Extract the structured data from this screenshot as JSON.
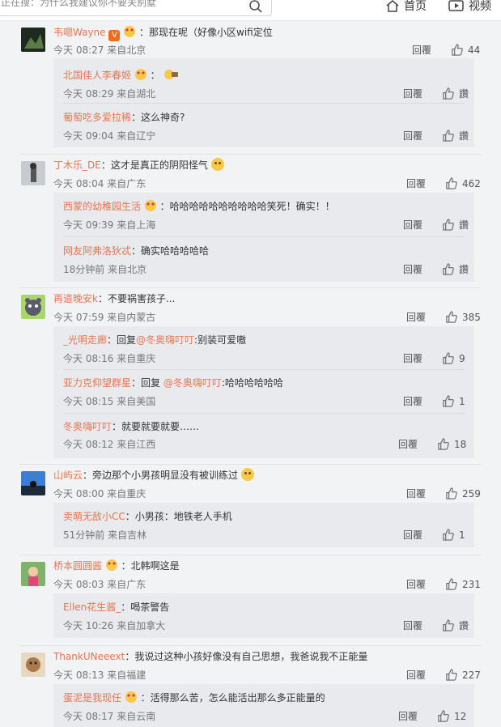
{
  "header": {
    "search_placeholder": "正在搜：为什么我建议你不要关别墅",
    "nav": [
      {
        "label": "首页",
        "icon": "home-icon"
      },
      {
        "label": "视频",
        "icon": "video-icon"
      }
    ]
  },
  "colors": {
    "name": "#eb7350",
    "reply_bg": "#e8eaed",
    "page_bg": "#f2f3f5"
  },
  "comments": [
    {
      "name": "韦嗯Wayne",
      "text": "：那现在呢（好像小区wifi定位",
      "meta": "今天 08:27 来自北京",
      "reply_label": "回覆",
      "likes": "44",
      "replies": [
        {
          "name": "北国佳人李春姬",
          "text": "：",
          "meta": "今天 08:29 来自湖北",
          "reply_label": "回覆",
          "likes": "讚"
        },
        {
          "name": "葡萄吃多爱拉稀",
          "text": "：这么神奇?",
          "meta": "今天 09:04 来自辽宁",
          "reply_label": "回覆",
          "likes": "讚"
        }
      ]
    },
    {
      "name": "丁木乐_DE",
      "text": "：这才是真正的阴阳怪气",
      "meta": "今天 08:04 来自广东",
      "reply_label": "回覆",
      "likes": "462",
      "replies": [
        {
          "name": "西蒙的幼稚园生活",
          "text": "：哈哈哈哈哈哈哈哈哈哈笑死！确实！！",
          "meta": "今天 09:39 来自上海",
          "reply_label": "回覆",
          "likes": "讚"
        },
        {
          "name": "网友阿弗洛狄忒",
          "text": "：确实哈哈哈哈哈",
          "meta": "18分钟前 来自北京",
          "reply_label": "回覆",
          "likes": "讚"
        }
      ]
    },
    {
      "name": "再道晚安k",
      "text": "：不要祸害孩子...",
      "meta": "今天 07:59 来自内蒙古",
      "reply_label": "回覆",
      "likes": "385",
      "replies": [
        {
          "name": "_光明走廊",
          "pre": "：回复",
          "mention": "@冬奥嗨叮叮",
          "text": ":别装可爱嗷",
          "meta": "今天 08:16 来自重庆",
          "reply_label": "回覆",
          "likes": "9"
        },
        {
          "name": "亚力克仰望群星",
          "pre": "：回复 ",
          "mention": "@冬奥嗨叮叮",
          "text": ":哈哈哈哈哈哈",
          "meta": "今天 08:15 来自美国",
          "reply_label": "回覆",
          "likes": "1"
        },
        {
          "name": "冬奥嗨叮叮",
          "text": "：就要就要就要……",
          "meta": "今天 08:12 来自江西",
          "reply_label": "回覆",
          "likes": "18"
        }
      ]
    },
    {
      "name": "山屿云",
      "text": "：旁边那个小男孩明显没有被训练过",
      "meta": "今天 08:00 来自重庆",
      "reply_label": "回覆",
      "likes": "259",
      "replies": [
        {
          "name": "卖萌无敌小CC",
          "text": "：小男孩：地铁老人手机",
          "meta": "51分钟前 来自吉林",
          "reply_label": "回覆",
          "likes": "1"
        }
      ]
    },
    {
      "name": "桥本圆圆酱",
      "text": "：北韩啊这是",
      "meta": "今天 08:03 来自广东",
      "reply_label": "回覆",
      "likes": "231",
      "replies": [
        {
          "name": "Ellen花生酱_",
          "text": "：喝茶警告",
          "meta": "今天 10:26 来自加拿大",
          "reply_label": "回覆",
          "likes": "讚"
        }
      ]
    },
    {
      "name": "ThankUNeeext",
      "text": "：我说过这种小孩好像没有自己思想，我爸说我不正能量",
      "meta": "今天 08:13 来自福建",
      "reply_label": "回覆",
      "likes": "227",
      "replies": [
        {
          "name": "蛋泥是我现任",
          "text": "：活得那么苦，怎么能活出那么多正能量的",
          "meta": "今天 08:17 来自云南",
          "reply_label": "回覆",
          "likes": "12"
        }
      ]
    }
  ]
}
